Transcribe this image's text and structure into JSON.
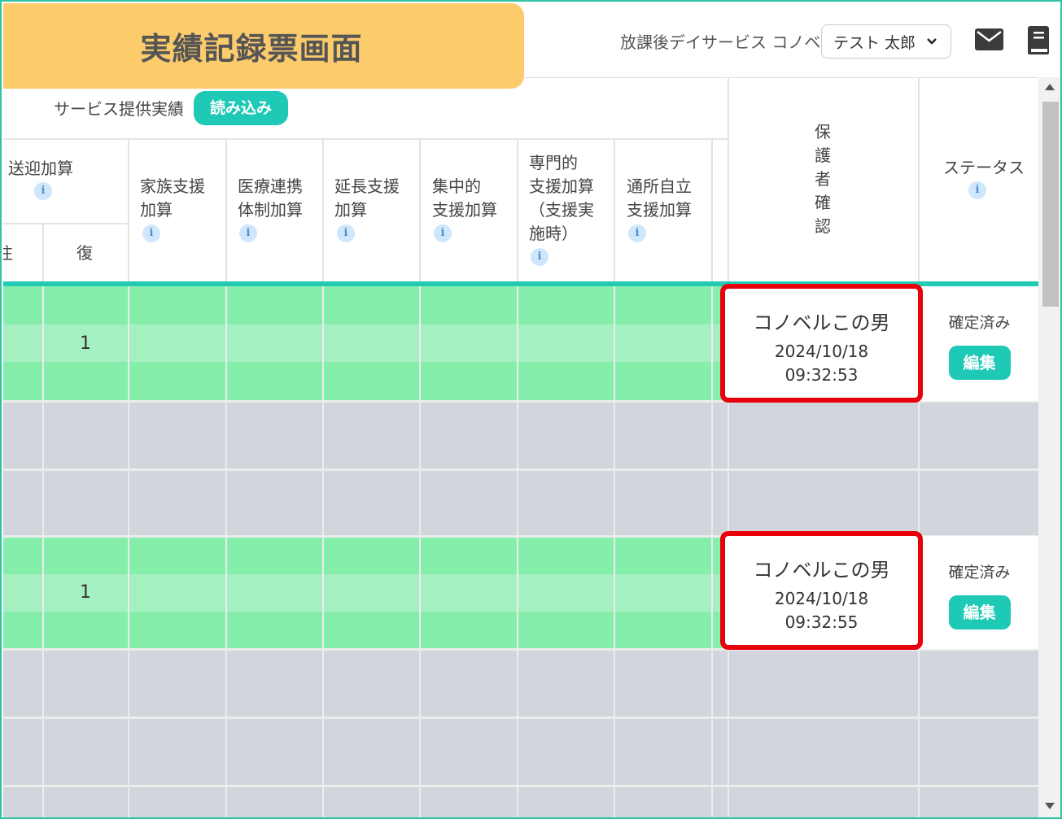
{
  "title_tag": "実績記録票画面",
  "header": {
    "facility": "放課後デイサービス コノベル",
    "user": "テスト 太郎"
  },
  "toolbar": {
    "service_label": "サービス提供実績",
    "load_button": "読み込み"
  },
  "columns": {
    "pickup": "送迎加算",
    "pickup_sub_left": "往",
    "pickup_sub_return": "復",
    "family_l1": "家族支援",
    "family_l2": "加算",
    "medical_l1": "医療連携",
    "medical_l2": "体制加算",
    "extension_l1": "延長支援",
    "extension_l2": "加算",
    "intensive_l1": "集中的",
    "intensive_l2": "支援加算",
    "specialist_l1": "専門的",
    "specialist_l2": "支援加算",
    "specialist_l3": "（支援実",
    "specialist_l4": "施時）",
    "commute_l1": "通所自立",
    "commute_l2": "支援加算",
    "guardian": [
      "保",
      "護",
      "者",
      "確",
      "認"
    ],
    "status": "ステータス",
    "info_glyph": "i"
  },
  "rows": [
    {
      "return_count": "1",
      "guardian_name": "コノベルこの男",
      "date": "2024/10/18",
      "time": "09:32:53",
      "status": "確定済み",
      "edit": "編集"
    },
    {
      "return_count": "1",
      "guardian_name": "コノベルこの男",
      "date": "2024/10/18",
      "time": "09:32:55",
      "status": "確定済み",
      "edit": "編集"
    }
  ],
  "colors": {
    "accent": "#1ec9b6",
    "highlight": "#e8000d",
    "row_done": "#86eeab",
    "row_empty": "#d2d5db",
    "tag": "#fccb6b"
  }
}
